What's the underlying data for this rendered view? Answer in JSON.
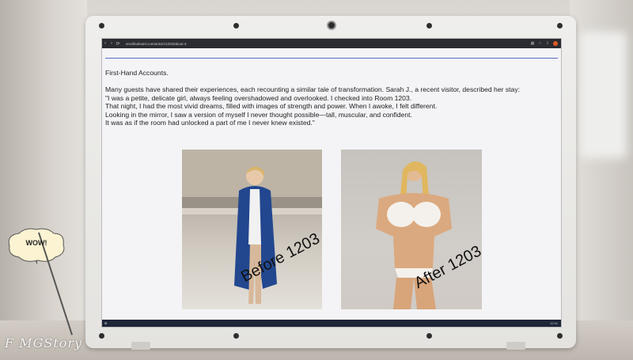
{
  "browser": {
    "url": "serafinahotel.com/article/1203/about-3",
    "nav_back": "‹",
    "nav_forward": "›",
    "nav_reload": "⟳"
  },
  "article": {
    "heading": "First-Hand Accounts.",
    "intro": "Many guests have shared their experiences, each recounting a similar tale of transformation. Sarah J., a recent visitor, described her stay:",
    "quote_lines": [
      "\"I was a petite, delicate girl, always feeling overshadowed and overlooked. I checked into Room 1203.",
      "That night, I had the most vivid dreams, filled with images of strength and power. When I awoke, I felt different.",
      "Looking in the mirror, I saw a version of myself I never thought possible—tall, muscular, and confident.",
      "It was as if the room had unlocked a part of me I never knew existed.\""
    ],
    "before_caption": "Before 1203",
    "after_caption": "After 1203"
  },
  "taskbar": {
    "clock": "12:11"
  },
  "overlay": {
    "speech_text": "WOW!",
    "watermark": "F MGStory"
  },
  "colors": {
    "browser_bar": "#2b2c31",
    "accent_line": "#5a6bc7",
    "taskbar": "#1f2638",
    "profile_badge": "#e05a23"
  }
}
